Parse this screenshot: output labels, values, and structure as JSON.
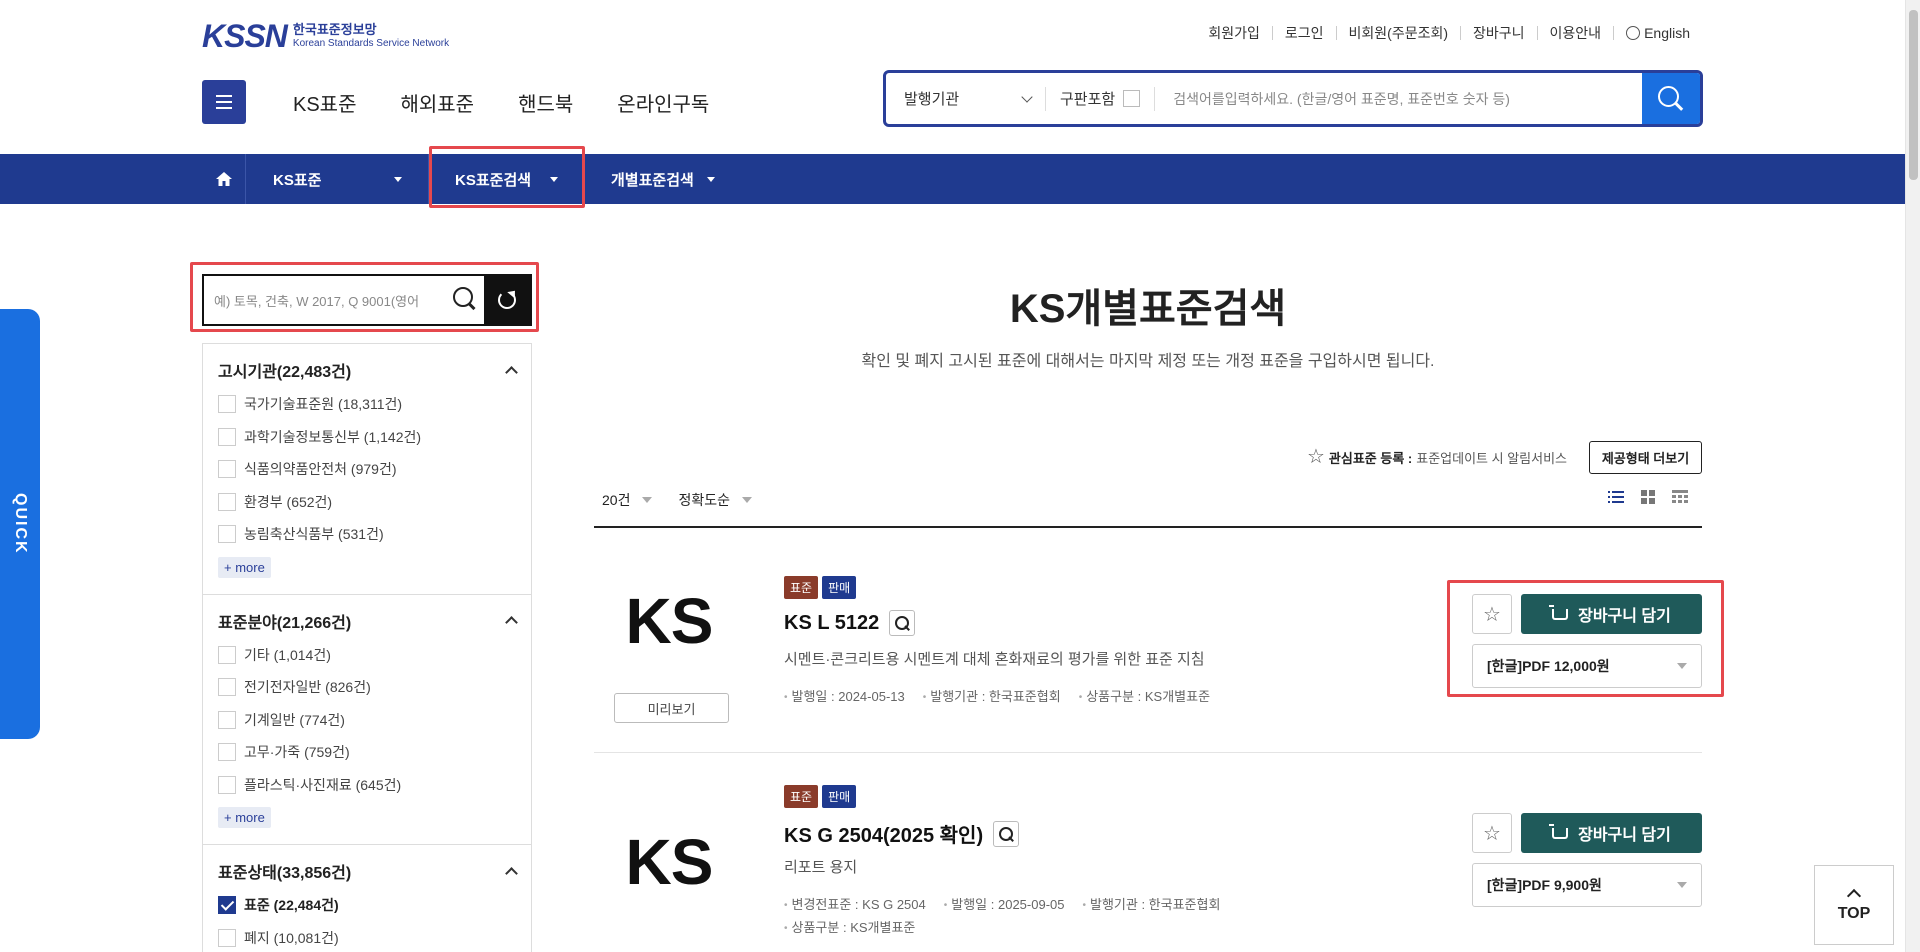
{
  "logo": {
    "mark": "KSSN",
    "ko": "한국표준정보망",
    "en": "Korean Standards Service Network"
  },
  "util": [
    "회원가입",
    "로그인",
    "비회원(주문조회)",
    "장바구니",
    "이용안내",
    "English"
  ],
  "gnb": [
    "KS표준",
    "해외표준",
    "핸드북",
    "온라인구독"
  ],
  "search": {
    "publisher": "발행기관",
    "include": "구판포함",
    "placeholder": "검색어를입력하세요. (한글/영어 표준명, 표준번호 숫자 등)"
  },
  "lnb": [
    "KS표준",
    "KS표준검색",
    "개별표준검색"
  ],
  "quick": "QUICK",
  "filter_search": {
    "placeholder": "예) 토목, 건축, W 2017, Q 9001(영어"
  },
  "filters": [
    {
      "title": "고시기관(22,483건)",
      "options": [
        {
          "label": "국가기술표준원 (18,311건)",
          "checked": false
        },
        {
          "label": "과학기술정보통신부 (1,142건)",
          "checked": false
        },
        {
          "label": "식품의약품안전처 (979건)",
          "checked": false
        },
        {
          "label": "환경부 (652건)",
          "checked": false
        },
        {
          "label": "농림축산식품부 (531건)",
          "checked": false
        }
      ],
      "more": "+ more"
    },
    {
      "title": "표준분야(21,266건)",
      "options": [
        {
          "label": "기타 (1,014건)",
          "checked": false
        },
        {
          "label": "전기전자일반 (826건)",
          "checked": false
        },
        {
          "label": "기계일반 (774건)",
          "checked": false
        },
        {
          "label": "고무·가죽 (759건)",
          "checked": false
        },
        {
          "label": "플라스틱·사진재료 (645건)",
          "checked": false
        }
      ],
      "more": "+ more"
    },
    {
      "title": "표준상태(33,856건)",
      "options": [
        {
          "label": "표준 (22,484건)",
          "checked": true
        },
        {
          "label": "폐지 (10,081건)",
          "checked": false
        }
      ]
    }
  ],
  "page": {
    "title": "KS개별표준검색",
    "subtitle": "확인 및 폐지 고시된 표준에 대해서는 마지막 제정 또는 개정 표준을 구입하시면 됩니다."
  },
  "fav_note": {
    "strong": "관심표준 등록 :",
    "text": "표준업데이트 시 알림서비스"
  },
  "offer_button": "제공형태 더보기",
  "sort": {
    "count": "20건",
    "order": "정확도순"
  },
  "results": [
    {
      "logo": "KS",
      "preview": "미리보기",
      "badges": [
        "표준",
        "판매"
      ],
      "code": "KS L 5122",
      "name": "시멘트·콘크리트용 시멘트계 대체 혼화재료의 평가를 위한 표준 지침",
      "meta": [
        "발행일 : 2024-05-13",
        "발행기관 : 한국표준협회",
        "상품구분 : KS개별표준"
      ],
      "cart": "장바구니 담기",
      "price": "[한글]PDF 12,000원"
    },
    {
      "logo": "KS",
      "badges": [
        "표준",
        "판매"
      ],
      "code": "KS G 2504(2025 확인)",
      "name": "리포트 용지",
      "meta": [
        "변경전표준 : KS G 2504",
        "발행일 : 2025-09-05",
        "발행기관 : 한국표준협회",
        "상품구분 : KS개별표준"
      ],
      "cart": "장바구니 담기",
      "price": "[한글]PDF 9,900원"
    }
  ],
  "top_button": "TOP"
}
